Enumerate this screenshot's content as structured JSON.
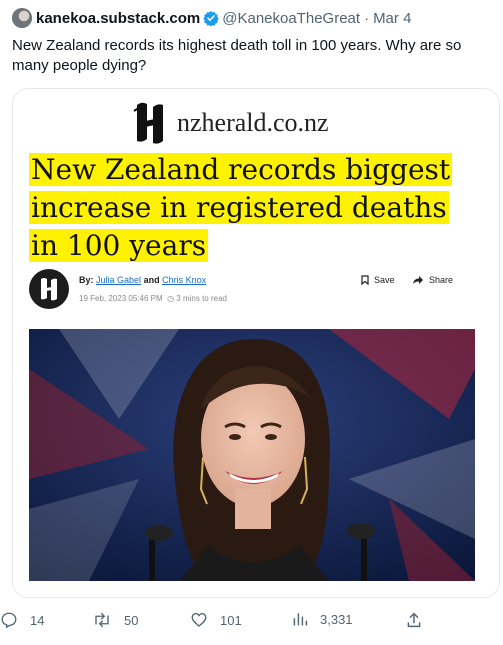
{
  "tweet": {
    "author_name": "kanekoa.substack.com",
    "handle": "@KanekoaTheGreat",
    "separator": "·",
    "date": "Mar 4",
    "text": "New Zealand records its highest death toll in 100 years. Why are so many people dying?"
  },
  "article": {
    "site": "nzherald.co.nz",
    "headline": "New Zealand records biggest increase in registered deaths in 100 years",
    "byline_prefix": "By:",
    "author1": "Julia Gabel",
    "and": "and",
    "author2": "Chris Knox",
    "timestamp": "19 Feb, 2023 05:46 PM",
    "read_time": "3 mins to read",
    "save_label": "Save",
    "share_label": "Share"
  },
  "actions": {
    "replies": "14",
    "reposts": "50",
    "likes": "101",
    "views": "3,331"
  },
  "colors": {
    "highlight": "#fff200",
    "verified": "#1d9bf0",
    "muted_text": "#536471",
    "link": "#1a6fc4"
  },
  "icons": [
    "verified-icon",
    "nzh-logo-icon",
    "bookmark-icon",
    "share-arrow-icon",
    "reply-icon",
    "repost-icon",
    "like-icon",
    "views-icon",
    "share-icon"
  ]
}
